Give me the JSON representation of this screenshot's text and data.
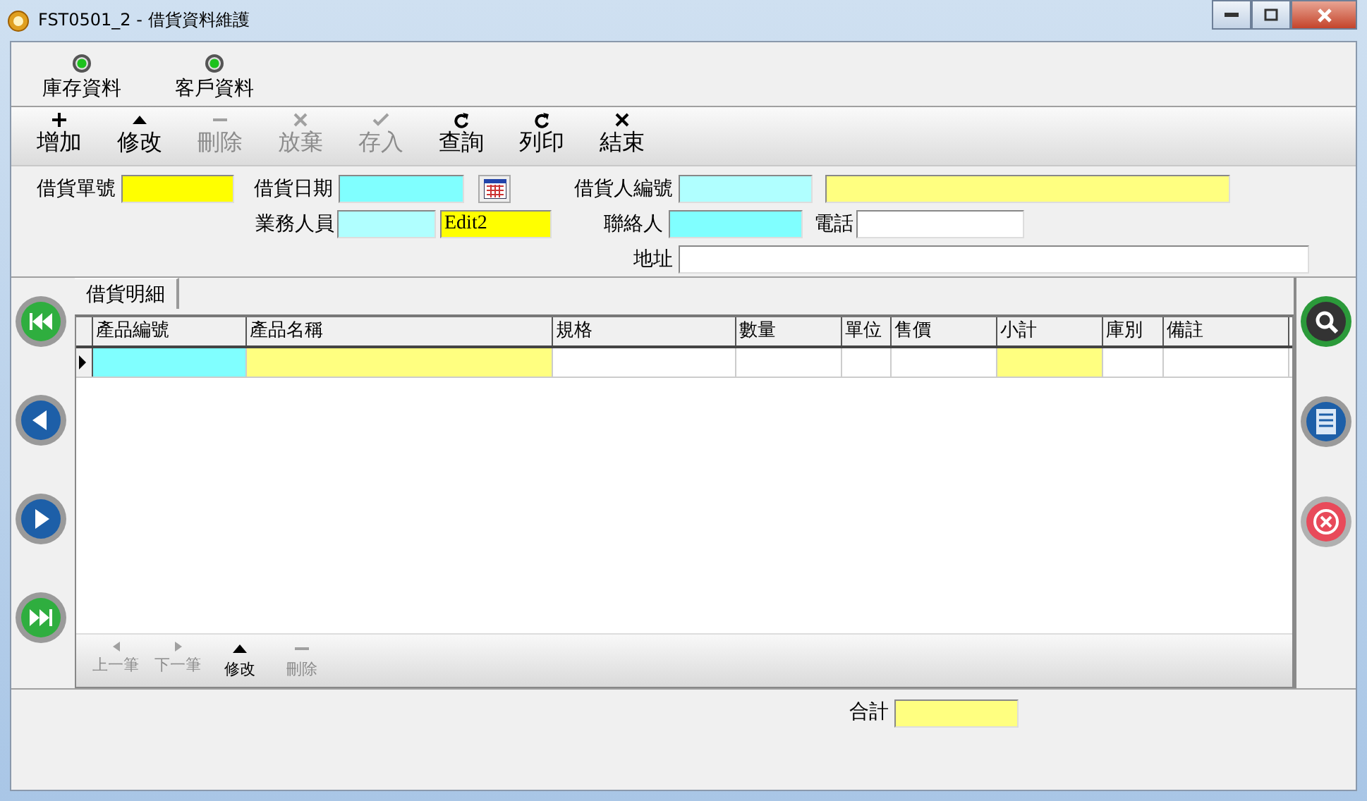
{
  "window": {
    "title": "FST0501_2 - 借貨資料維護"
  },
  "links": [
    {
      "label": "庫存資料"
    },
    {
      "label": "客戶資料"
    }
  ],
  "toolbar": [
    {
      "label": "增加",
      "kind": "plus",
      "disabled": false
    },
    {
      "label": "修改",
      "kind": "up",
      "disabled": false
    },
    {
      "label": "刪除",
      "kind": "minus",
      "disabled": true
    },
    {
      "label": "放棄",
      "kind": "cross",
      "disabled": true
    },
    {
      "label": "存入",
      "kind": "check",
      "disabled": true
    },
    {
      "label": "查詢",
      "kind": "redo",
      "disabled": false
    },
    {
      "label": "列印",
      "kind": "redo",
      "disabled": false
    },
    {
      "label": "結束",
      "kind": "cross",
      "disabled": false
    }
  ],
  "form": {
    "order_no": {
      "label": "借貨單號",
      "color": "#ffff00"
    },
    "date": {
      "label": "借貨日期",
      "color": "#80ffff"
    },
    "borrower": {
      "label": "借貨人編號",
      "color": "#b0ffff"
    },
    "borrower_name": {
      "color": "#ffff80"
    },
    "salesperson": {
      "label": "業務人員",
      "color": "#b0ffff"
    },
    "salesperson_name": {
      "value": "Edit2",
      "color": "#ffff00"
    },
    "contact": {
      "label": "聯絡人",
      "color": "#80ffff"
    },
    "phone": {
      "label": "電話",
      "color": "#ffffff"
    },
    "address": {
      "label": "地址",
      "color": "#ffffff"
    }
  },
  "tabs": [
    {
      "label": "借貨明細",
      "selected": true
    }
  ],
  "table": {
    "columns": [
      {
        "label": "產品編號",
        "color": "#80ffff"
      },
      {
        "label": "產品名稱",
        "color": "#ffff80"
      },
      {
        "label": "規格",
        "color": "#ffffff"
      },
      {
        "label": "數量",
        "color": "#ffffff"
      },
      {
        "label": "單位",
        "color": "#ffffff"
      },
      {
        "label": "售價",
        "color": "#ffffff"
      },
      {
        "label": "小計",
        "color": "#ffff80"
      },
      {
        "label": "庫別",
        "color": "#ffffff"
      },
      {
        "label": "備註",
        "color": "#ffffff"
      }
    ],
    "rows": [
      {
        "selected": true
      }
    ]
  },
  "detail_nav": [
    {
      "label": "上一筆",
      "kind": "left",
      "disabled": true
    },
    {
      "label": "下一筆",
      "kind": "right",
      "disabled": true
    },
    {
      "label": "修改",
      "kind": "up",
      "disabled": false
    },
    {
      "label": "刪除",
      "kind": "minus",
      "disabled": true
    }
  ],
  "total": {
    "label": "合計",
    "color": "#ffff80"
  }
}
